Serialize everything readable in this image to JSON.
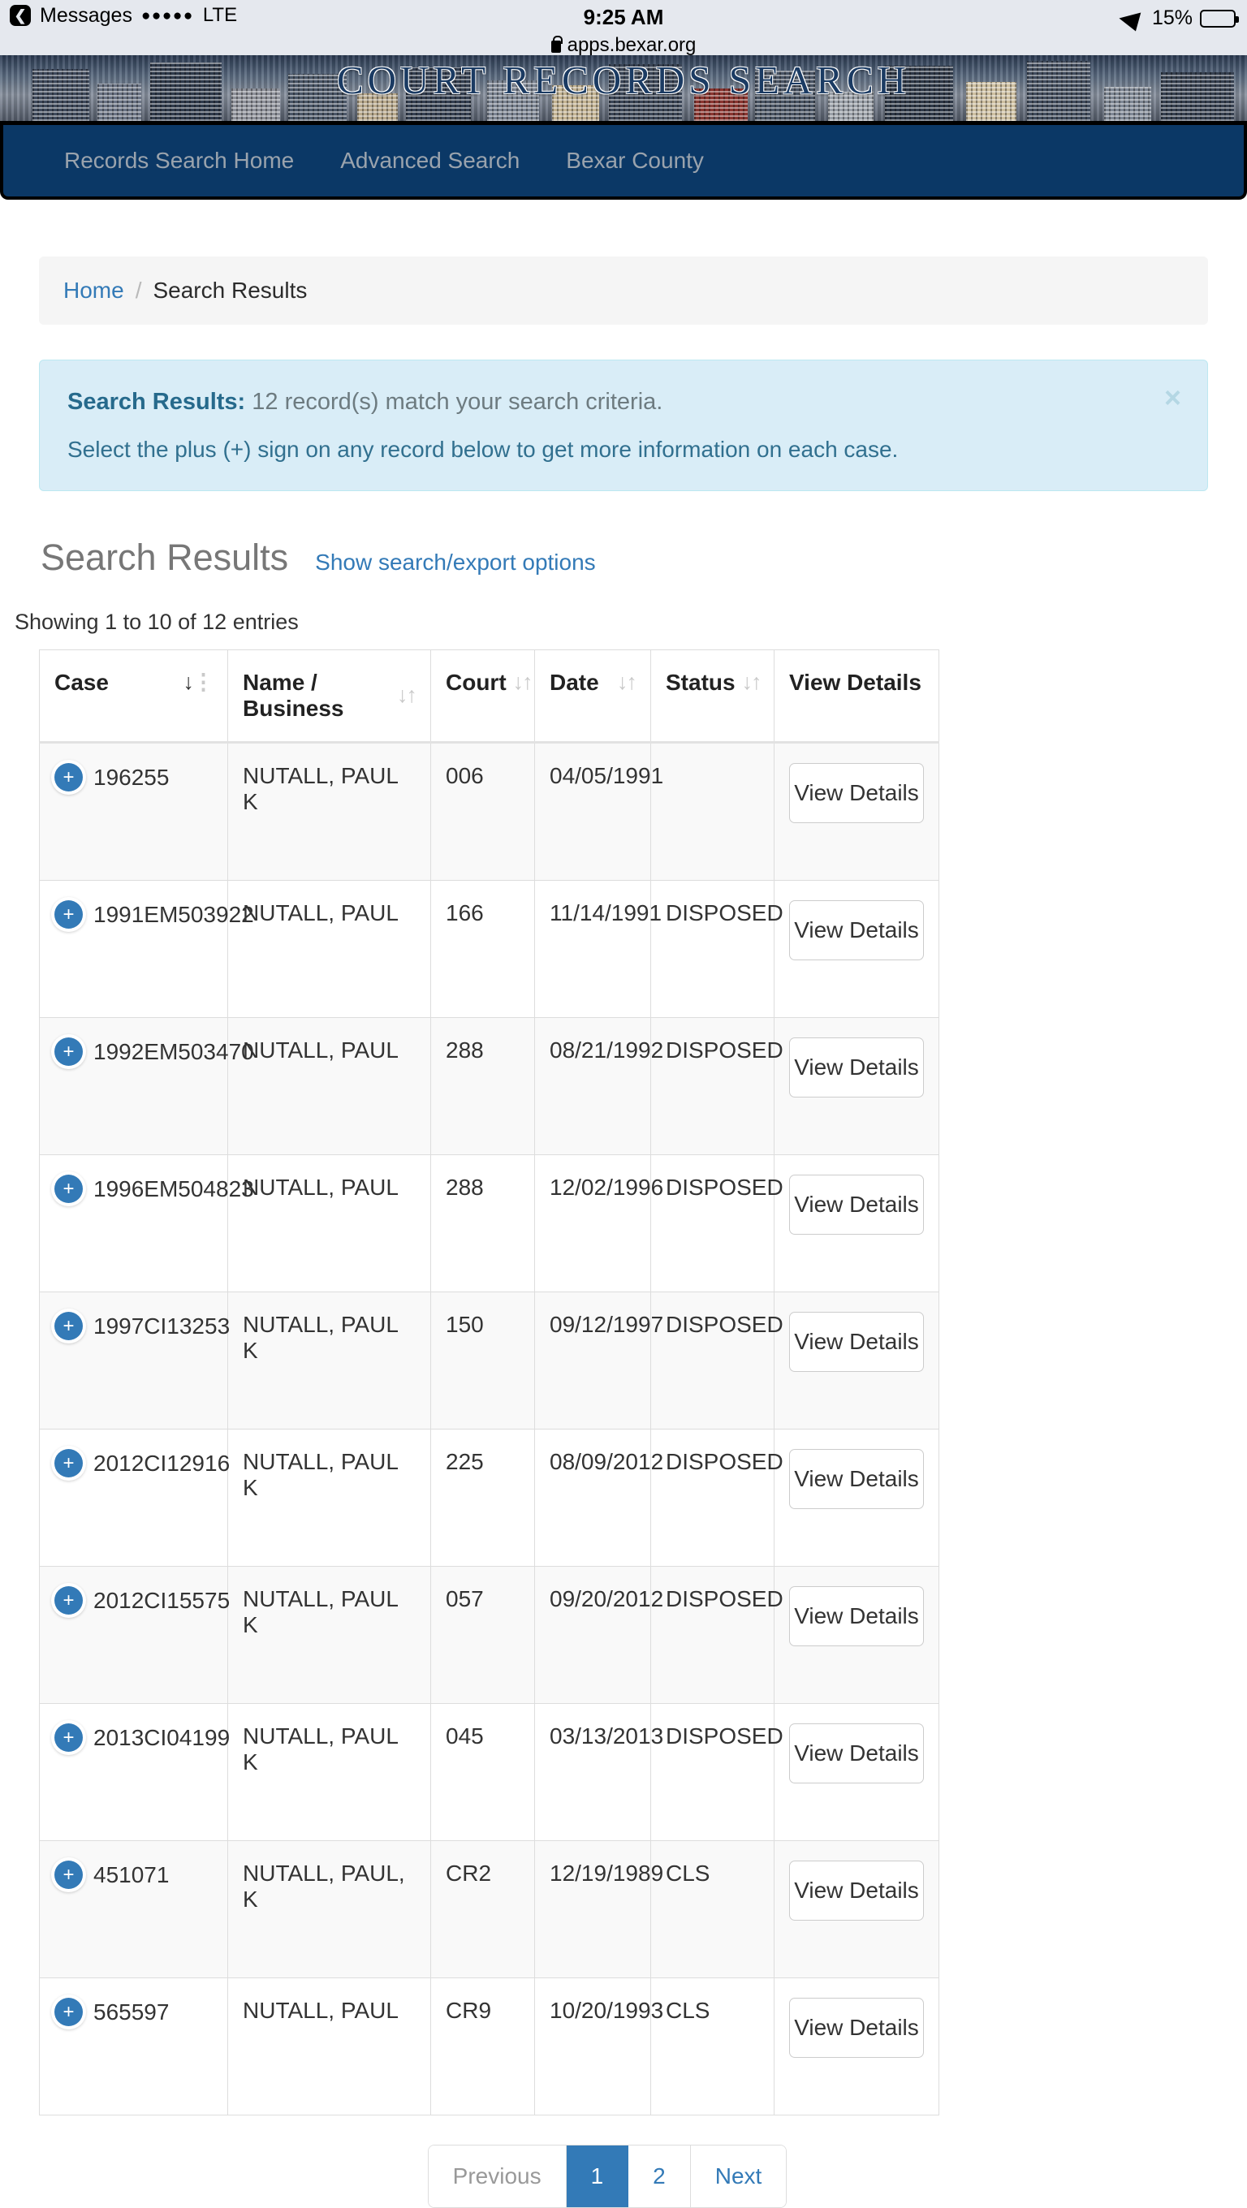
{
  "status_bar": {
    "carrier_app": "Messages",
    "signal_dots": "●●●●●",
    "network": "LTE",
    "time": "9:25 AM",
    "url": "apps.bexar.org",
    "battery_percent": "15%",
    "battery_level": 15
  },
  "banner": {
    "title": "COURT RECORDS SEARCH"
  },
  "navbar": {
    "links": [
      {
        "label": "Records Search Home"
      },
      {
        "label": "Advanced Search"
      },
      {
        "label": "Bexar County"
      }
    ],
    "background": "#0b3866",
    "link_color": "#9aa3ad"
  },
  "breadcrumb": {
    "home": "Home",
    "separator": "/",
    "current": "Search Results"
  },
  "alert": {
    "title": "Search Results:",
    "summary": "12 record(s) match your search criteria.",
    "instruction": "Select the plus (+) sign on any record below to get more information on each case.",
    "close_label": "×",
    "background": "#d9edf7",
    "text_color": "#31708f"
  },
  "results_header": {
    "title": "Search Results",
    "export_link": "Show search/export options"
  },
  "showing": "Showing 1 to 10 of 12 entries",
  "table": {
    "columns": [
      {
        "label": "Case",
        "sort": "desc"
      },
      {
        "label": "Name / Business",
        "sort": "none"
      },
      {
        "label": "Court",
        "sort": "none"
      },
      {
        "label": "Date",
        "sort": "none"
      },
      {
        "label": "Status",
        "sort": "none"
      },
      {
        "label": "View Details",
        "sort": null
      }
    ],
    "view_details_label": "View Details",
    "expand_label": "+",
    "rows": [
      {
        "case": "196255",
        "name": "NUTALL, PAUL K",
        "court": "006",
        "date": "04/05/1991",
        "status": ""
      },
      {
        "case": "1991EM503922",
        "name": "NUTALL, PAUL",
        "court": "166",
        "date": "11/14/1991",
        "status": "DISPOSED"
      },
      {
        "case": "1992EM503470",
        "name": "NUTALL, PAUL",
        "court": "288",
        "date": "08/21/1992",
        "status": "DISPOSED"
      },
      {
        "case": "1996EM504823",
        "name": "NUTALL, PAUL",
        "court": "288",
        "date": "12/02/1996",
        "status": "DISPOSED"
      },
      {
        "case": "1997CI13253",
        "name": "NUTALL, PAUL K",
        "court": "150",
        "date": "09/12/1997",
        "status": "DISPOSED"
      },
      {
        "case": "2012CI12916",
        "name": "NUTALL, PAUL K",
        "court": "225",
        "date": "08/09/2012",
        "status": "DISPOSED"
      },
      {
        "case": "2012CI15575",
        "name": "NUTALL, PAUL K",
        "court": "057",
        "date": "09/20/2012",
        "status": "DISPOSED"
      },
      {
        "case": "2013CI04199",
        "name": "NUTALL, PAUL K",
        "court": "045",
        "date": "03/13/2013",
        "status": "DISPOSED"
      },
      {
        "case": "451071",
        "name": "NUTALL, PAUL, K",
        "court": "CR2",
        "date": "12/19/1989",
        "status": "CLS"
      },
      {
        "case": "565597",
        "name": "NUTALL, PAUL",
        "court": "CR9",
        "date": "10/20/1993",
        "status": "CLS"
      }
    ]
  },
  "pagination": {
    "previous": "Previous",
    "pages": [
      "1",
      "2"
    ],
    "active_page": "1",
    "next": "Next",
    "active_color": "#337ab7"
  }
}
